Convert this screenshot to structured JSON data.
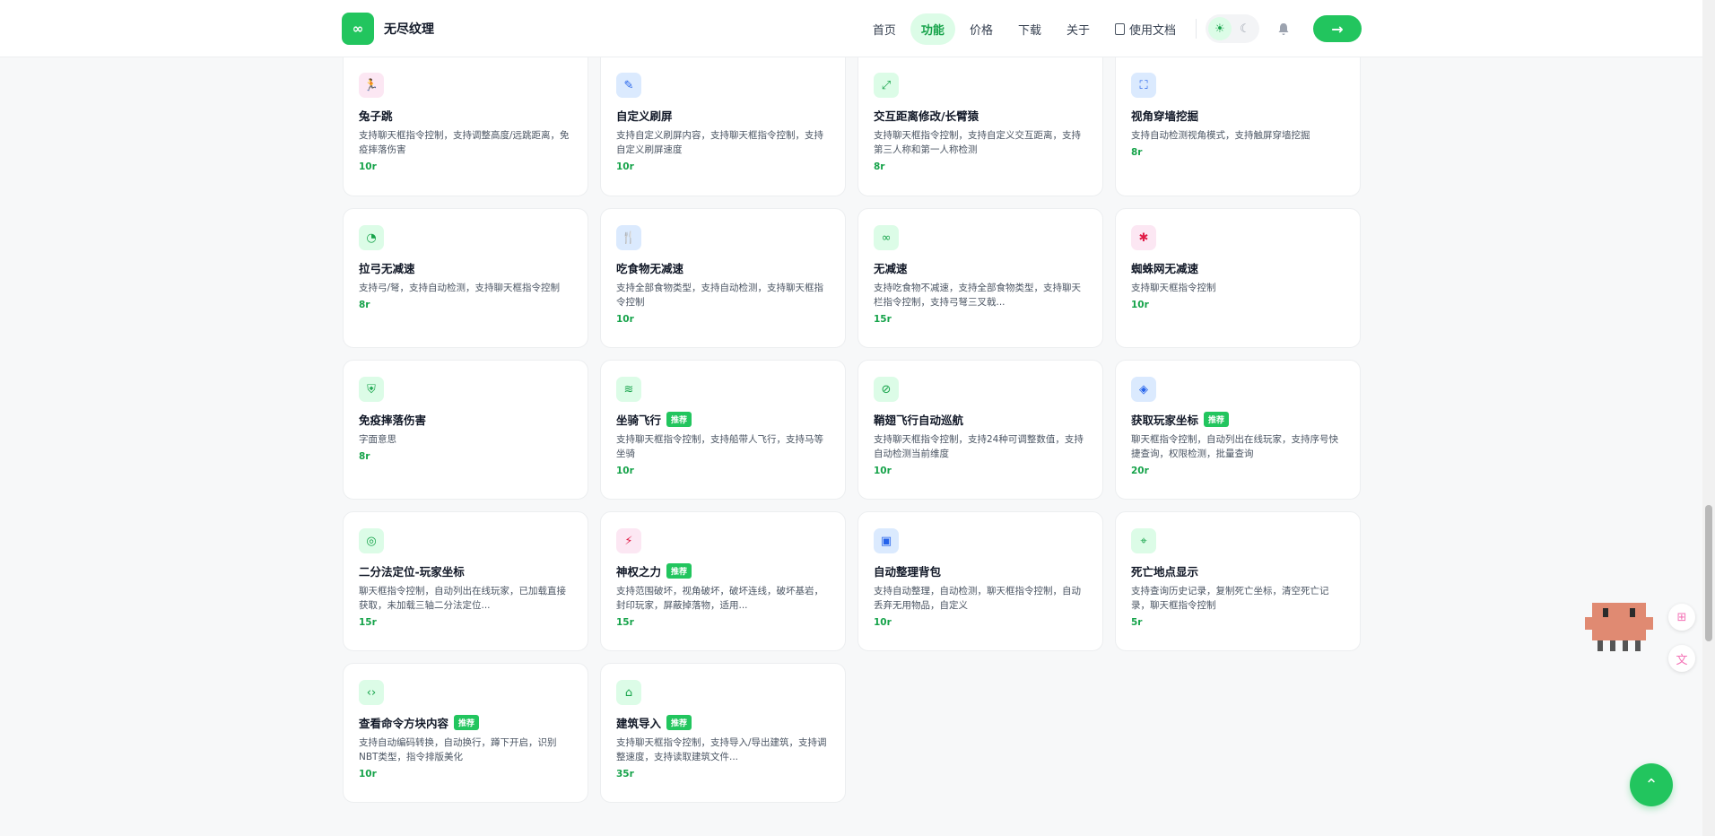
{
  "header": {
    "logo_glyph": "∞",
    "brand": "无尽纹理",
    "nav": [
      {
        "label": "首页",
        "active": false
      },
      {
        "label": "功能",
        "active": true
      },
      {
        "label": "价格",
        "active": false
      },
      {
        "label": "下载",
        "active": false
      },
      {
        "label": "关于",
        "active": false
      }
    ],
    "docs_label": "使用文档",
    "theme_light_icon": "☀",
    "theme_dark_icon": "☾",
    "bell_icon": "🔔",
    "go_icon": "→"
  },
  "cards": [
    {
      "icon": "running-icon",
      "glyph": "🏃",
      "tone": "pink",
      "title": "兔子跳",
      "badge": "",
      "desc": "支持聊天框指令控制，支持调整高度/远跳距离，免疫摔落伤害",
      "rounds": "10r"
    },
    {
      "icon": "brush-icon",
      "glyph": "✎",
      "tone": "blue",
      "title": "自定义刷屏",
      "badge": "",
      "desc": "支持自定义刷屏内容，支持聊天框指令控制，支持自定义刷屏速度",
      "rounds": "10r"
    },
    {
      "icon": "expand-icon",
      "glyph": "⤢",
      "tone": "green",
      "title": "交互距离修改/长臂猿",
      "badge": "",
      "desc": "支持聊天框指令控制，支持自定义交互距离，支持第三人称和第一人称检测",
      "rounds": "8r"
    },
    {
      "icon": "scan-icon",
      "glyph": "⛶",
      "tone": "blue",
      "title": "视角穿墙挖掘",
      "badge": "",
      "desc": "支持自动检测视角模式，支持触屏穿墙挖掘",
      "rounds": "8r"
    },
    {
      "icon": "gauge-icon",
      "glyph": "◔",
      "tone": "green",
      "title": "拉弓无减速",
      "badge": "",
      "desc": "支持弓/弩，支持自动检测，支持聊天框指令控制",
      "rounds": "8r"
    },
    {
      "icon": "utensils-icon",
      "glyph": "🍴",
      "tone": "blue",
      "title": "吃食物无减速",
      "badge": "",
      "desc": "支持全部食物类型，支持自动检测，支持聊天框指令控制",
      "rounds": "10r"
    },
    {
      "icon": "infinity-icon",
      "glyph": "∞",
      "tone": "green",
      "title": "无减速",
      "badge": "",
      "desc": "支持吃食物不减速，支持全部食物类型，支持聊天栏指令控制，支持弓弩三叉戟...",
      "rounds": "15r"
    },
    {
      "icon": "bug-icon",
      "glyph": "✱",
      "tone": "pink",
      "title": "蜘蛛网无减速",
      "badge": "",
      "desc": "支持聊天框指令控制",
      "rounds": "10r"
    },
    {
      "icon": "shield-icon",
      "glyph": "⛨",
      "tone": "green",
      "title": "免疫摔落伤害",
      "badge": "",
      "desc": "字面意思",
      "rounds": "8r"
    },
    {
      "icon": "saddle-icon",
      "glyph": "≋",
      "tone": "green",
      "title": "坐骑飞行",
      "badge": "推荐",
      "desc": "支持聊天框指令控制，支持船带人飞行，支持马等坐骑",
      "rounds": "10r"
    },
    {
      "icon": "compass-icon",
      "glyph": "⊘",
      "tone": "green",
      "title": "鞘翅飞行自动巡航",
      "badge": "",
      "desc": "支持聊天框指令控制，支持24种可调整数值，支持自动检测当前维度",
      "rounds": "10r"
    },
    {
      "icon": "locate-icon",
      "glyph": "◈",
      "tone": "blue",
      "title": "获取玩家坐标",
      "badge": "推荐",
      "desc": "聊天框指令控制，自动列出在线玩家，支持序号快捷查询，权限检测，批量查询",
      "rounds": "20r"
    },
    {
      "icon": "target-icon",
      "glyph": "◎",
      "tone": "green",
      "title": "二分法定位-玩家坐标",
      "badge": "",
      "desc": "聊天框指令控制，自动列出在线玩家，已加载直接获取，未加载三轴二分法定位...",
      "rounds": "15r"
    },
    {
      "icon": "lightning-icon",
      "glyph": "⚡",
      "tone": "pink",
      "title": "神权之力",
      "badge": "推荐",
      "desc": "支持范围破坏，视角破坏，破坏连线，破坏基岩，封印玩家，屏蔽掉落物，适用...",
      "rounds": "15r"
    },
    {
      "icon": "archive-icon",
      "glyph": "▣",
      "tone": "blue",
      "title": "自动整理背包",
      "badge": "",
      "desc": "支持自动整理，自动检测，聊天框指令控制，自动丢弃无用物品，自定义",
      "rounds": "10r"
    },
    {
      "icon": "map-pin-icon",
      "glyph": "⌖",
      "tone": "green",
      "title": "死亡地点显示",
      "badge": "",
      "desc": "支持查询历史记录，复制死亡坐标，清空死亡记录，聊天框指令控制",
      "rounds": "5r"
    },
    {
      "icon": "code-icon",
      "glyph": "‹›",
      "tone": "green",
      "title": "查看命令方块内容",
      "badge": "推荐",
      "desc": "支持自动编码转换，自动换行，蹲下开启，识别NBT类型，指令排版美化",
      "rounds": "10r"
    },
    {
      "icon": "building-icon",
      "glyph": "⌂",
      "tone": "green",
      "title": "建筑导入",
      "badge": "推荐",
      "desc": "支持聊天框指令控制，支持导入/导出建筑，支持调整速度，支持读取建筑文件...",
      "rounds": "35r"
    }
  ],
  "floating": {
    "add_icon": "⊞",
    "translate_icon": "文",
    "back_to_top_icon": "⌃"
  }
}
